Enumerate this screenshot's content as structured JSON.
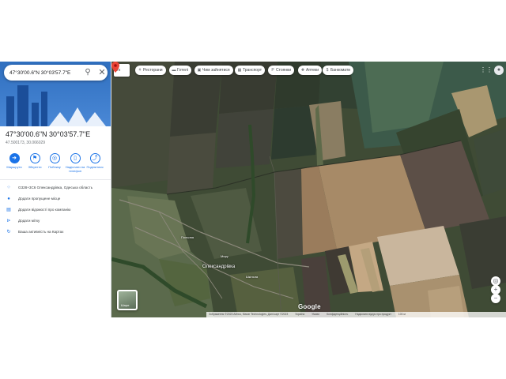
{
  "search": {
    "value": "47°30'00.6\"N 30°03'57.7\"E"
  },
  "panel": {
    "title": "47°30'00.6\"N 30°03'57.7\"E",
    "subtitle": "47.500173, 30.066029",
    "actions": [
      {
        "label": "Маршрути",
        "icon": "directions-icon",
        "glyph": "➜"
      },
      {
        "label": "Зберегти",
        "icon": "bookmark-icon",
        "glyph": "⚑"
      },
      {
        "label": "Поблизу",
        "icon": "nearby-icon",
        "glyph": "◎"
      },
      {
        "label": "Надіслати на телефон",
        "icon": "phone-icon",
        "glyph": "▯"
      },
      {
        "label": "Поділитися",
        "icon": "share-icon",
        "glyph": "⤴"
      }
    ],
    "info": [
      {
        "text": "G328+3C6 Олександрівка, Одеська область",
        "icon": "plus-code-icon",
        "glyph": "⁘"
      },
      {
        "text": "Додати пропущене місце",
        "icon": "add-place-icon",
        "glyph": "●"
      },
      {
        "text": "Додати відомості про компанію",
        "icon": "business-icon",
        "glyph": "▤"
      },
      {
        "text": "Додати мітку",
        "icon": "label-icon",
        "glyph": "⊳"
      },
      {
        "text": "Ваша активність на Картах",
        "icon": "history-icon",
        "glyph": "↻"
      }
    ]
  },
  "map": {
    "lang_label": "Ук",
    "chips": [
      {
        "label": "Ресторани",
        "icon": "restaurant-icon",
        "glyph": "🍴"
      },
      {
        "label": "Готелі",
        "icon": "hotel-icon",
        "glyph": "▬"
      },
      {
        "label": "Чим зайнятися",
        "icon": "activities-icon",
        "glyph": "▣"
      },
      {
        "label": "Транспорт",
        "icon": "transit-icon",
        "glyph": "▦"
      },
      {
        "label": "Стоянки",
        "icon": "parking-icon",
        "glyph": "P"
      },
      {
        "label": "Аптеки",
        "icon": "pharmacy-icon",
        "glyph": "✚"
      },
      {
        "label": "Банкомати",
        "icon": "atm-icon",
        "glyph": "$"
      }
    ],
    "village_label": "Олександрівка",
    "road_labels": [
      "Польова",
      "Миру",
      "Шкільна"
    ],
    "layers_label": "Шари",
    "logo": "Google",
    "attribution": [
      "Зображення ©2023 Airbus, Maxar Technologies, Дані карт ©2023",
      "Україна",
      "Умови",
      "Конфіденційність",
      "Надіслати відгук про продукт",
      "100 м"
    ]
  },
  "colors": {
    "accent": "#1a73e8",
    "pin": "#ea4335"
  }
}
